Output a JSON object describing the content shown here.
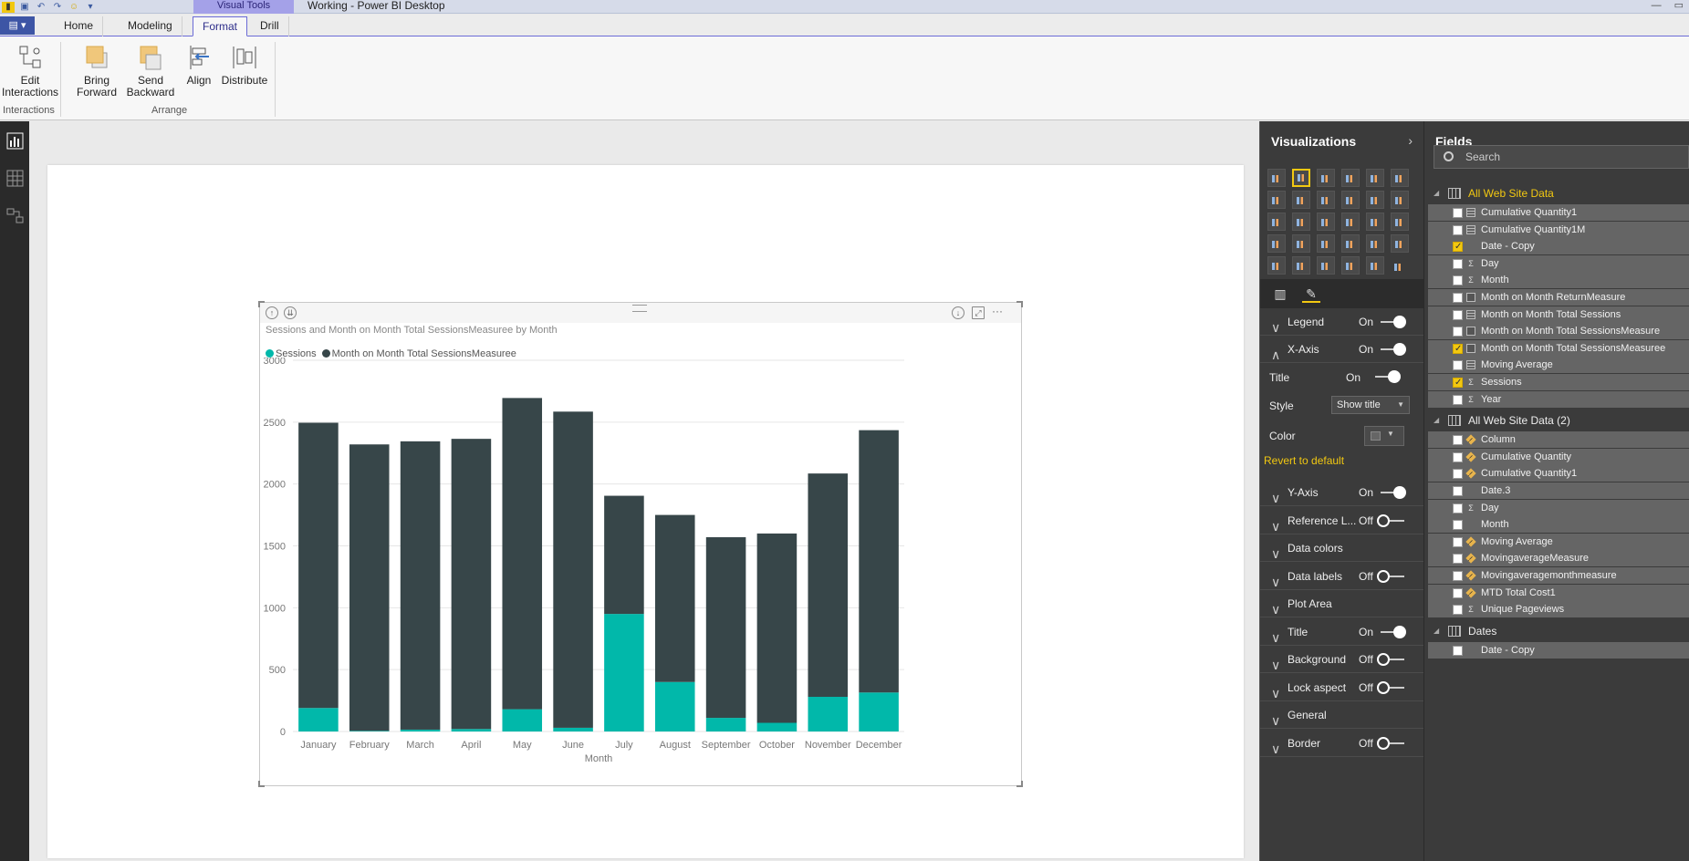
{
  "app": {
    "window_title": "Working - Power BI Desktop",
    "context_tab": "Visual Tools"
  },
  "ribbon": {
    "tabs": [
      {
        "label": "Home",
        "active": false
      },
      {
        "label": "Modeling",
        "active": false
      },
      {
        "label": "Format",
        "active": true
      },
      {
        "label": "Drill",
        "active": false
      }
    ],
    "buttons": {
      "edit_interactions": "Edit\nInteractions",
      "bring_forward": "Bring\nForward",
      "send_backward": "Send\nBackward",
      "align": "Align",
      "distribute": "Distribute"
    },
    "groups": {
      "interactions": "Interactions",
      "arrange": "Arrange"
    }
  },
  "visual": {
    "title": "Sessions and Month on Month Total SessionsMeasuree by Month",
    "legend": [
      {
        "name": "Sessions",
        "color": "#01b8aa"
      },
      {
        "name": "Month on Month Total SessionsMeasuree",
        "color": "#374649"
      }
    ]
  },
  "chart_data": {
    "type": "bar",
    "stacked": true,
    "title": "Sessions and Month on Month Total SessionsMeasuree by Month",
    "xlabel": "Month",
    "ylabel": "",
    "ylim": [
      0,
      3000
    ],
    "yticks": [
      0,
      500,
      1000,
      1500,
      2000,
      2500,
      3000
    ],
    "categories": [
      "January",
      "February",
      "March",
      "April",
      "May",
      "June",
      "July",
      "August",
      "September",
      "October",
      "November",
      "December"
    ],
    "series": [
      {
        "name": "Sessions",
        "color": "#01b8aa",
        "values": [
          190,
          5,
          15,
          20,
          180,
          30,
          950,
          400,
          110,
          70,
          280,
          315
        ]
      },
      {
        "name": "Month on Month Total SessionsMeasuree",
        "color": "#374649",
        "values": [
          2305,
          2315,
          2330,
          2345,
          2515,
          2555,
          955,
          1350,
          1460,
          1530,
          1805,
          2120
        ]
      }
    ],
    "grid": true,
    "legend_position": "top-left"
  },
  "visualizations": {
    "header": "Visualizations",
    "format_rows": [
      {
        "label": "Legend",
        "state": "On",
        "chev": "∨"
      },
      {
        "label": "X-Axis",
        "state": "On",
        "chev": "∧"
      }
    ],
    "xaxis": {
      "title_label": "Title",
      "title_state": "On",
      "style_label": "Style",
      "style_value": "Show title",
      "color_label": "Color",
      "revert": "Revert to default"
    },
    "more_rows": [
      {
        "label": "Y-Axis",
        "state": "On"
      },
      {
        "label": "Reference L...",
        "state": "Off"
      },
      {
        "label": "Data colors",
        "state": ""
      },
      {
        "label": "Data labels",
        "state": "Off"
      },
      {
        "label": "Plot Area",
        "state": ""
      },
      {
        "label": "Title",
        "state": "On"
      },
      {
        "label": "Background",
        "state": "Off"
      },
      {
        "label": "Lock aspect",
        "state": "Off"
      },
      {
        "label": "General",
        "state": ""
      },
      {
        "label": "Border",
        "state": "Off"
      }
    ]
  },
  "fields": {
    "header": "Fields",
    "search_placeholder": "Search",
    "tables": [
      {
        "name": "All Web Site Data",
        "highlight": true,
        "items": [
          {
            "name": "Cumulative Quantity1",
            "icon": "calc",
            "checked": false
          },
          {
            "name": "Cumulative Quantity1M",
            "icon": "calc",
            "checked": false
          },
          {
            "name": "Date - Copy",
            "icon": "",
            "checked": true
          },
          {
            "name": "Day",
            "icon": "sigma",
            "checked": false
          },
          {
            "name": "Month",
            "icon": "sigma",
            "checked": false
          },
          {
            "name": "Month on Month ReturnMeasure",
            "icon": "measure",
            "checked": false
          },
          {
            "name": "Month on Month Total Sessions",
            "icon": "calc",
            "checked": false
          },
          {
            "name": "Month on Month Total SessionsMeasure",
            "icon": "measure",
            "checked": false
          },
          {
            "name": "Month on Month Total SessionsMeasuree",
            "icon": "measure",
            "checked": true
          },
          {
            "name": "Moving Average",
            "icon": "calc",
            "checked": false
          },
          {
            "name": "Sessions",
            "icon": "sigma",
            "checked": true
          },
          {
            "name": "Year",
            "icon": "sigma",
            "checked": false
          }
        ]
      },
      {
        "name": "All Web Site Data (2)",
        "highlight": false,
        "items": [
          {
            "name": "Column",
            "icon": "warn",
            "checked": false
          },
          {
            "name": "Cumulative Quantity",
            "icon": "warn",
            "checked": false
          },
          {
            "name": "Cumulative Quantity1",
            "icon": "warn",
            "checked": false
          },
          {
            "name": "Date.3",
            "icon": "",
            "checked": false
          },
          {
            "name": "Day",
            "icon": "sigma",
            "checked": false
          },
          {
            "name": "Month",
            "icon": "",
            "checked": false
          },
          {
            "name": "Moving Average",
            "icon": "warn",
            "checked": false
          },
          {
            "name": "MovingaverageMeasure",
            "icon": "warn",
            "checked": false
          },
          {
            "name": "Movingaveragemonthmeasure",
            "icon": "warn",
            "checked": false
          },
          {
            "name": "MTD Total Cost1",
            "icon": "warn",
            "checked": false
          },
          {
            "name": "Unique Pageviews",
            "icon": "sigma",
            "checked": false
          }
        ]
      },
      {
        "name": "Dates",
        "highlight": false,
        "items": [
          {
            "name": "Date - Copy",
            "icon": "",
            "checked": false
          }
        ]
      }
    ]
  }
}
